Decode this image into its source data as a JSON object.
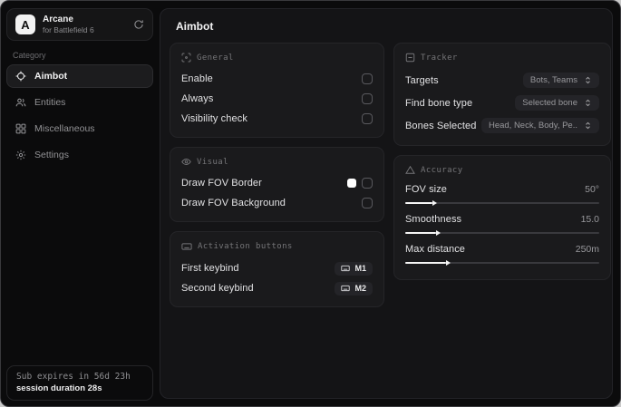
{
  "colors": {
    "window_bg": "#0b0b0c",
    "panel_bg": "#141416",
    "card_bg": "#1a1a1c",
    "accent_fill": "#f5f5f5",
    "fov_border_swatch": "#ffffff"
  },
  "sidebar": {
    "app": {
      "logo_letter": "A",
      "name": "Arcane",
      "subtitle": "for Battlefield 6"
    },
    "category_label": "Category",
    "items": [
      {
        "label": "Aimbot",
        "icon": "crosshair-icon",
        "active": true
      },
      {
        "label": "Entities",
        "icon": "users-icon",
        "active": false
      },
      {
        "label": "Miscellaneous",
        "icon": "grid-icon",
        "active": false
      },
      {
        "label": "Settings",
        "icon": "gear-icon",
        "active": false
      }
    ],
    "footer": {
      "line1": "Sub expires in 56d 23h",
      "line2": "session duration 28s"
    }
  },
  "main": {
    "title": "Aimbot",
    "general": {
      "header": "General",
      "rows": [
        {
          "label": "Enable",
          "checked": false
        },
        {
          "label": "Always",
          "checked": false
        },
        {
          "label": "Visibility check",
          "checked": false
        }
      ]
    },
    "visual": {
      "header": "Visual",
      "rows": [
        {
          "label": "Draw FOV Border",
          "swatch": "#ffffff",
          "checked": false
        },
        {
          "label": "Draw FOV Background",
          "checked": false
        }
      ]
    },
    "activation": {
      "header": "Activation buttons",
      "rows": [
        {
          "label": "First keybind",
          "key": "M1"
        },
        {
          "label": "Second keybind",
          "key": "M2"
        }
      ]
    },
    "tracker": {
      "header": "Tracker",
      "rows": [
        {
          "label": "Targets",
          "value": "Bots, Teams"
        },
        {
          "label": "Find bone type",
          "value": "Selected bone"
        },
        {
          "label": "Bones Selected",
          "value": "Head, Neck, Body, Pe.."
        }
      ]
    },
    "accuracy": {
      "header": "Accuracy",
      "rows": [
        {
          "label": "FOV size",
          "value": "50°",
          "percent": 14
        },
        {
          "label": "Smoothness",
          "value": "15.0",
          "percent": 16
        },
        {
          "label": "Max distance",
          "value": "250m",
          "percent": 21
        }
      ]
    }
  }
}
